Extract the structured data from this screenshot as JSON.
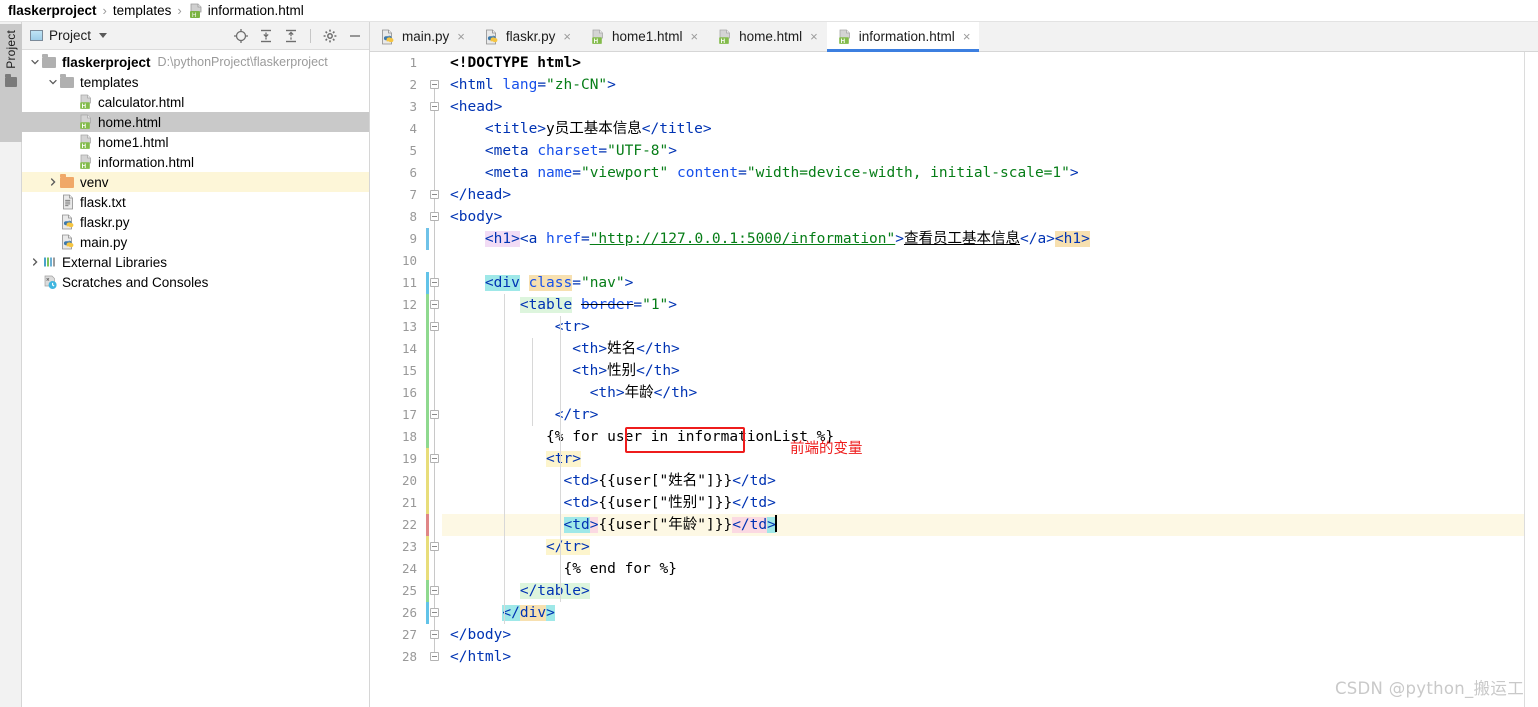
{
  "breadcrumb": {
    "items": [
      {
        "label": "flaskerproject",
        "icon": "none",
        "bold": true
      },
      {
        "label": "templates",
        "icon": "none",
        "bold": false
      },
      {
        "label": "information.html",
        "icon": "html-file-icon",
        "bold": false
      }
    ],
    "separator": "›"
  },
  "tool_strip": {
    "project_tab_label": "Project",
    "project_tab_icon": "folder-icon"
  },
  "project_panel": {
    "header": {
      "title": "Project",
      "panel_icon": "project-panel-icon",
      "dropdown_icon": "chevron-down-icon",
      "tools": [
        {
          "name": "locate-icon",
          "title": "Select Opened File"
        },
        {
          "name": "expand-all-icon",
          "title": "Expand All"
        },
        {
          "name": "collapse-all-icon",
          "title": "Collapse All"
        },
        {
          "name": "gear-icon",
          "title": "Settings"
        },
        {
          "name": "minimize-icon",
          "title": "Hide"
        }
      ]
    },
    "tree": [
      {
        "label": "flaskerproject",
        "path": "D:\\pythonProject\\flaskerproject",
        "icon": "folder-icon",
        "indent": 0,
        "twisty": "expanded",
        "bold": true,
        "state": "normal"
      },
      {
        "label": "templates",
        "path": "",
        "icon": "folder-icon",
        "indent": 1,
        "twisty": "expanded",
        "bold": false,
        "state": "normal"
      },
      {
        "label": "calculator.html",
        "path": "",
        "icon": "html-file-icon",
        "indent": 2,
        "twisty": "none",
        "bold": false,
        "state": "normal"
      },
      {
        "label": "home.html",
        "path": "",
        "icon": "html-file-icon",
        "indent": 2,
        "twisty": "none",
        "bold": false,
        "state": "selected"
      },
      {
        "label": "home1.html",
        "path": "",
        "icon": "html-file-icon",
        "indent": 2,
        "twisty": "none",
        "bold": false,
        "state": "normal"
      },
      {
        "label": "information.html",
        "path": "",
        "icon": "html-file-icon",
        "indent": 2,
        "twisty": "none",
        "bold": false,
        "state": "normal"
      },
      {
        "label": "venv",
        "path": "",
        "icon": "folder-orange-icon",
        "indent": 1,
        "twisty": "collapsed",
        "bold": false,
        "state": "highlighted"
      },
      {
        "label": "flask.txt",
        "path": "",
        "icon": "text-file-icon",
        "indent": 1,
        "twisty": "none",
        "bold": false,
        "state": "normal"
      },
      {
        "label": "flaskr.py",
        "path": "",
        "icon": "python-file-icon",
        "indent": 1,
        "twisty": "none",
        "bold": false,
        "state": "normal"
      },
      {
        "label": "main.py",
        "path": "",
        "icon": "python-file-icon",
        "indent": 1,
        "twisty": "none",
        "bold": false,
        "state": "normal"
      },
      {
        "label": "External Libraries",
        "path": "",
        "icon": "libraries-icon",
        "indent": 0,
        "twisty": "collapsed",
        "bold": false,
        "state": "normal"
      },
      {
        "label": "Scratches and Consoles",
        "path": "",
        "icon": "scratches-icon",
        "indent": 0,
        "twisty": "none",
        "bold": false,
        "state": "normal"
      }
    ]
  },
  "editor": {
    "tabs": [
      {
        "label": "main.py",
        "icon": "python-file-icon",
        "active": false,
        "close_icon": "close-icon"
      },
      {
        "label": "flaskr.py",
        "icon": "python-file-icon",
        "active": false,
        "close_icon": "close-icon"
      },
      {
        "label": "home1.html",
        "icon": "html-file-icon",
        "active": false,
        "close_icon": "close-icon"
      },
      {
        "label": "home.html",
        "icon": "html-file-icon",
        "active": false,
        "close_icon": "close-icon"
      },
      {
        "label": "information.html",
        "icon": "html-file-icon",
        "active": true,
        "close_icon": "close-icon"
      }
    ],
    "active_tab_accent": "#3c7fe0",
    "current_line": 22,
    "line_numbers": [
      1,
      2,
      3,
      4,
      5,
      6,
      7,
      8,
      9,
      10,
      11,
      12,
      13,
      14,
      15,
      16,
      17,
      18,
      19,
      20,
      21,
      22,
      23,
      24,
      25,
      26,
      27,
      28
    ],
    "lines": [
      {
        "n": 1,
        "text": "<!DOCTYPE html>"
      },
      {
        "n": 2,
        "text": "<html lang=\"zh-CN\">"
      },
      {
        "n": 3,
        "text": "<head>"
      },
      {
        "n": 4,
        "text": "    <title>y员工基本信息</title>"
      },
      {
        "n": 5,
        "text": "    <meta charset=\"UTF-8\">"
      },
      {
        "n": 6,
        "text": "    <meta name=\"viewport\" content=\"width=device-width, initial-scale=1\">"
      },
      {
        "n": 7,
        "text": "</head>"
      },
      {
        "n": 8,
        "text": "<body>"
      },
      {
        "n": 9,
        "text": "    <h1><a href=\"http://127.0.0.1:5000/information\">查看员工基本信息</a><h1>"
      },
      {
        "n": 10,
        "text": ""
      },
      {
        "n": 11,
        "text": "    <div class=\"nav\">"
      },
      {
        "n": 12,
        "text": "        <table border=\"1\">"
      },
      {
        "n": 13,
        "text": "            <tr>"
      },
      {
        "n": 14,
        "text": "              <th>姓名</th>"
      },
      {
        "n": 15,
        "text": "              <th>性别</th>"
      },
      {
        "n": 16,
        "text": "                <th>年龄</th>"
      },
      {
        "n": 17,
        "text": "            </tr>"
      },
      {
        "n": 18,
        "text": "           {% for user in informationList %}"
      },
      {
        "n": 19,
        "text": "           <tr>"
      },
      {
        "n": 20,
        "text": "             <td>{{user[\"姓名\"]}}</td>"
      },
      {
        "n": 21,
        "text": "             <td>{{user[\"性别\"]}}</td>"
      },
      {
        "n": 22,
        "text": "             <td>{{user[\"年龄\"]}}</td>"
      },
      {
        "n": 23,
        "text": "           </tr>"
      },
      {
        "n": 24,
        "text": "             {% end for %}"
      },
      {
        "n": 25,
        "text": "        </table>"
      },
      {
        "n": 26,
        "text": "      </div>"
      },
      {
        "n": 27,
        "text": "</body>"
      },
      {
        "n": 28,
        "text": "</html>"
      }
    ]
  },
  "annotation": {
    "box_target": "informationList",
    "note_text": "前端的变量",
    "color": "#ee1c1c"
  },
  "watermark": {
    "text": "CSDN @python_搬运工"
  }
}
